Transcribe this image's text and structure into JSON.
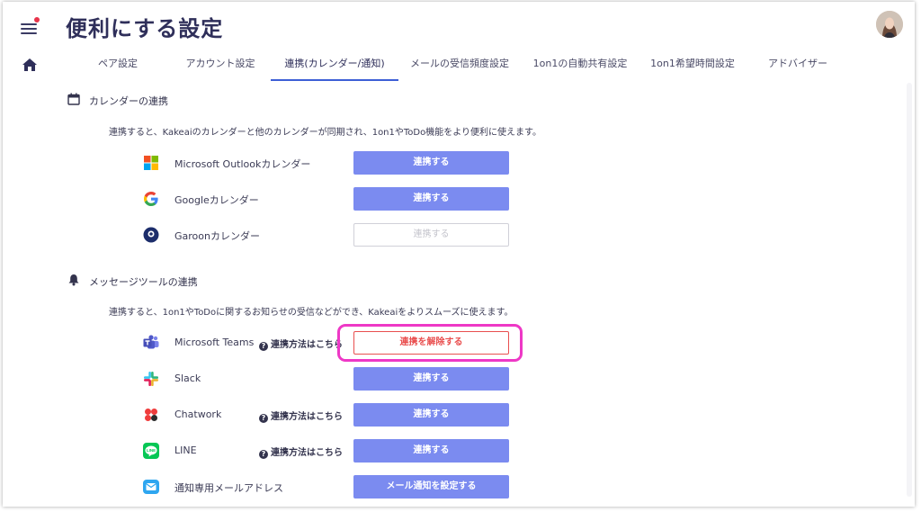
{
  "header": {
    "title": "便利にする設定"
  },
  "tabs": [
    {
      "label": "ペア設定",
      "active": false
    },
    {
      "label": "アカウント設定",
      "active": false
    },
    {
      "label": "連携(カレンダー/通知)",
      "active": true
    },
    {
      "label": "メールの受信頻度設定",
      "active": false
    },
    {
      "label": "1on1の自動共有設定",
      "active": false
    },
    {
      "label": "1on1希望時間設定",
      "active": false
    },
    {
      "label": "アドバイザー",
      "active": false
    }
  ],
  "calendar": {
    "title": "カレンダーの連携",
    "description": "連携すると、Kakeaiのカレンダーと他のカレンダーが同期され、1on1やToDo機能をより便利に使えます。",
    "items": [
      {
        "name": "Microsoft Outlookカレンダー",
        "button": "連携する"
      },
      {
        "name": "Googleカレンダー",
        "button": "連携する"
      },
      {
        "name": "Garoonカレンダー",
        "button": "連携する"
      }
    ]
  },
  "messaging": {
    "title": "メッセージツールの連携",
    "description": "連携すると、1on1やToDoに関するお知らせの受信などができ、Kakeaiをよりスムーズに使えます。",
    "help_label": "連携方法はこちら",
    "items": [
      {
        "name": "Microsoft Teams",
        "button": "連携を解除する"
      },
      {
        "name": "Slack",
        "button": "連携する"
      },
      {
        "name": "Chatwork",
        "button": "連携する"
      },
      {
        "name": "LINE",
        "button": "連携する"
      },
      {
        "name": "通知専用メールアドレス",
        "button": "メール通知を設定する"
      }
    ]
  },
  "colors": {
    "primary_button": "#7b8bf0",
    "danger": "#e94f4f",
    "highlight": "#ee38c6",
    "tab_underline": "#3d5fd6"
  },
  "icons": {
    "menu": "hamburger-icon",
    "home": "home-icon",
    "calendar": "calendar-icon",
    "bell": "bell-icon",
    "help": "question-circle-icon"
  }
}
